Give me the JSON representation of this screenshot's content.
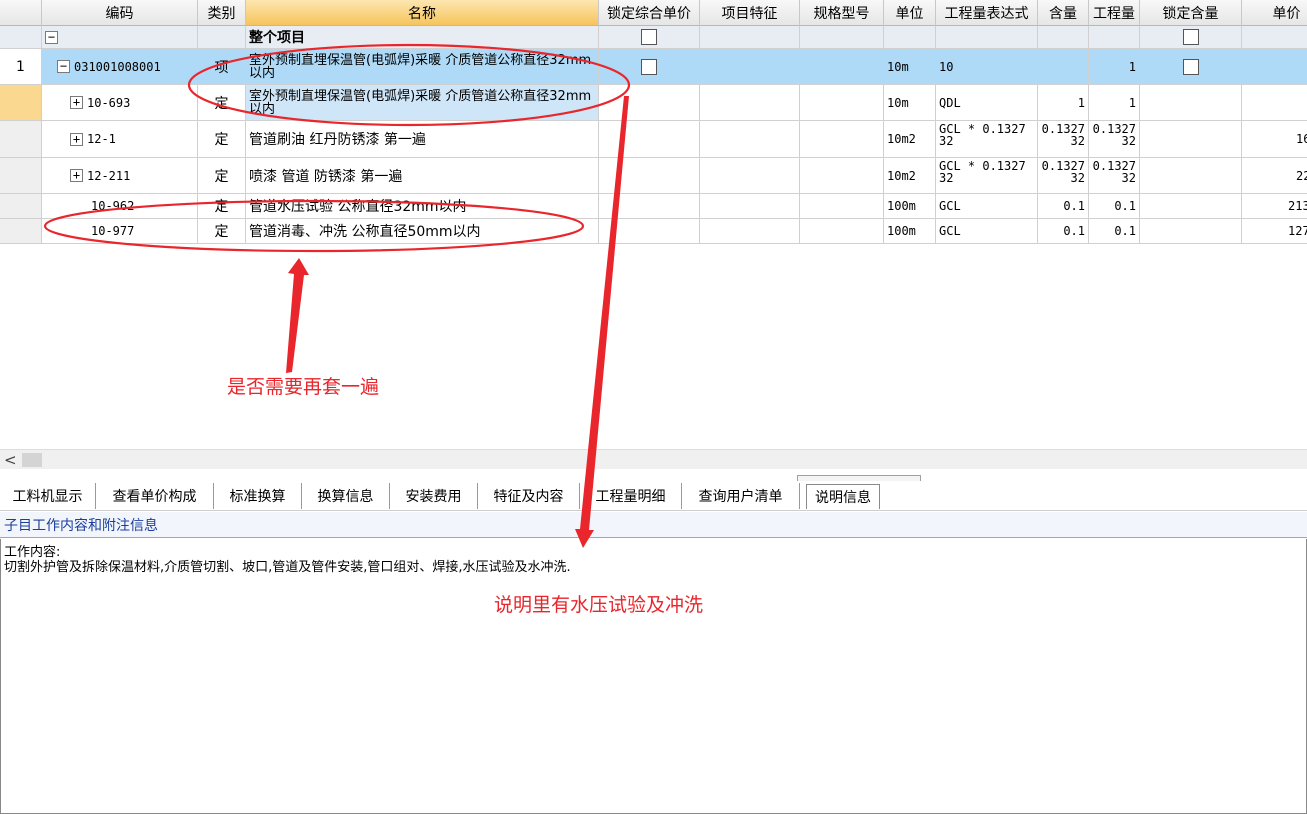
{
  "columns": [
    "编码",
    "类别",
    "名称",
    "锁定综合单价",
    "项目特征",
    "规格型号",
    "单位",
    "工程量表达式",
    "含量",
    "工程量",
    "锁定含量",
    "单价"
  ],
  "active_column": "名称",
  "rows": [
    {
      "id": "row0",
      "num": "",
      "expander": "−",
      "code": "",
      "type": "",
      "name": "整个项目",
      "lock_price": "checkbox",
      "unit": "",
      "expr": "",
      "content": "",
      "qty": "",
      "lock_content": "checkbox",
      "price": ""
    },
    {
      "id": "row1",
      "num": "1",
      "expander": "−",
      "code": "031001008001",
      "type": "项",
      "name": "室外预制直埋保温管(电弧焊)采暖 介质管道公称直径32mm以内",
      "lock_price": "checkbox",
      "unit": "10m",
      "expr": "10",
      "content": "",
      "qty": "1",
      "lock_content": "checkbox",
      "price": ""
    },
    {
      "id": "row2",
      "num": "",
      "expander": "+",
      "code": "10-693",
      "type": "定",
      "name": "室外预制直埋保温管(电弧焊)采暖 介质管道公称直径32mm以内",
      "unit": "10m",
      "expr": "QDL",
      "content": "1",
      "qty": "1",
      "price": ""
    },
    {
      "id": "row3",
      "num": "",
      "expander": "+",
      "code": "12-1",
      "type": "定",
      "name": "管道刷油 红丹防锈漆 第一遍",
      "unit": "10m2",
      "expr": "GCL * 0.1327 32",
      "content": "0.1327 32",
      "qty": "0.1327 32",
      "price": "16"
    },
    {
      "id": "row4",
      "num": "",
      "expander": "+",
      "code": "12-211",
      "type": "定",
      "name": "喷漆 管道 防锈漆 第一遍",
      "unit": "10m2",
      "expr": "GCL * 0.1327 32",
      "content": "0.1327 32",
      "qty": "0.1327 32",
      "price": "22"
    },
    {
      "id": "row5",
      "num": "",
      "expander": "",
      "code": "10-962",
      "type": "定",
      "name": "管道水压试验 公称直径32mm以内",
      "unit": "100m",
      "expr": "GCL",
      "content": "0.1",
      "qty": "0.1",
      "price": "213"
    },
    {
      "id": "row6",
      "num": "",
      "expander": "",
      "code": "10-977",
      "type": "定",
      "name": "管道消毒、冲洗 公称直径50mm以内",
      "unit": "100m",
      "expr": "GCL",
      "content": "0.1",
      "qty": "0.1",
      "price": "127"
    }
  ],
  "scrollbar": {
    "left_arrow": "<"
  },
  "tabs": [
    "工料机显示",
    "查看单价构成",
    "标准换算",
    "换算信息",
    "安装费用",
    "特征及内容",
    "工程量明细",
    "查询用户清单",
    "说明信息"
  ],
  "active_tab": "说明信息",
  "section_title": "子目工作内容和附注信息",
  "description": {
    "line1": "工作内容:",
    "line2": "切割外护管及拆除保温材料,介质管切割、坡口,管道及管件安装,管口组对、焊接,水压试验及水冲洗."
  },
  "annotations": {
    "question": "是否需要再套一遍",
    "note": "说明里有水压试验及冲洗",
    "color": "#e8262b"
  }
}
